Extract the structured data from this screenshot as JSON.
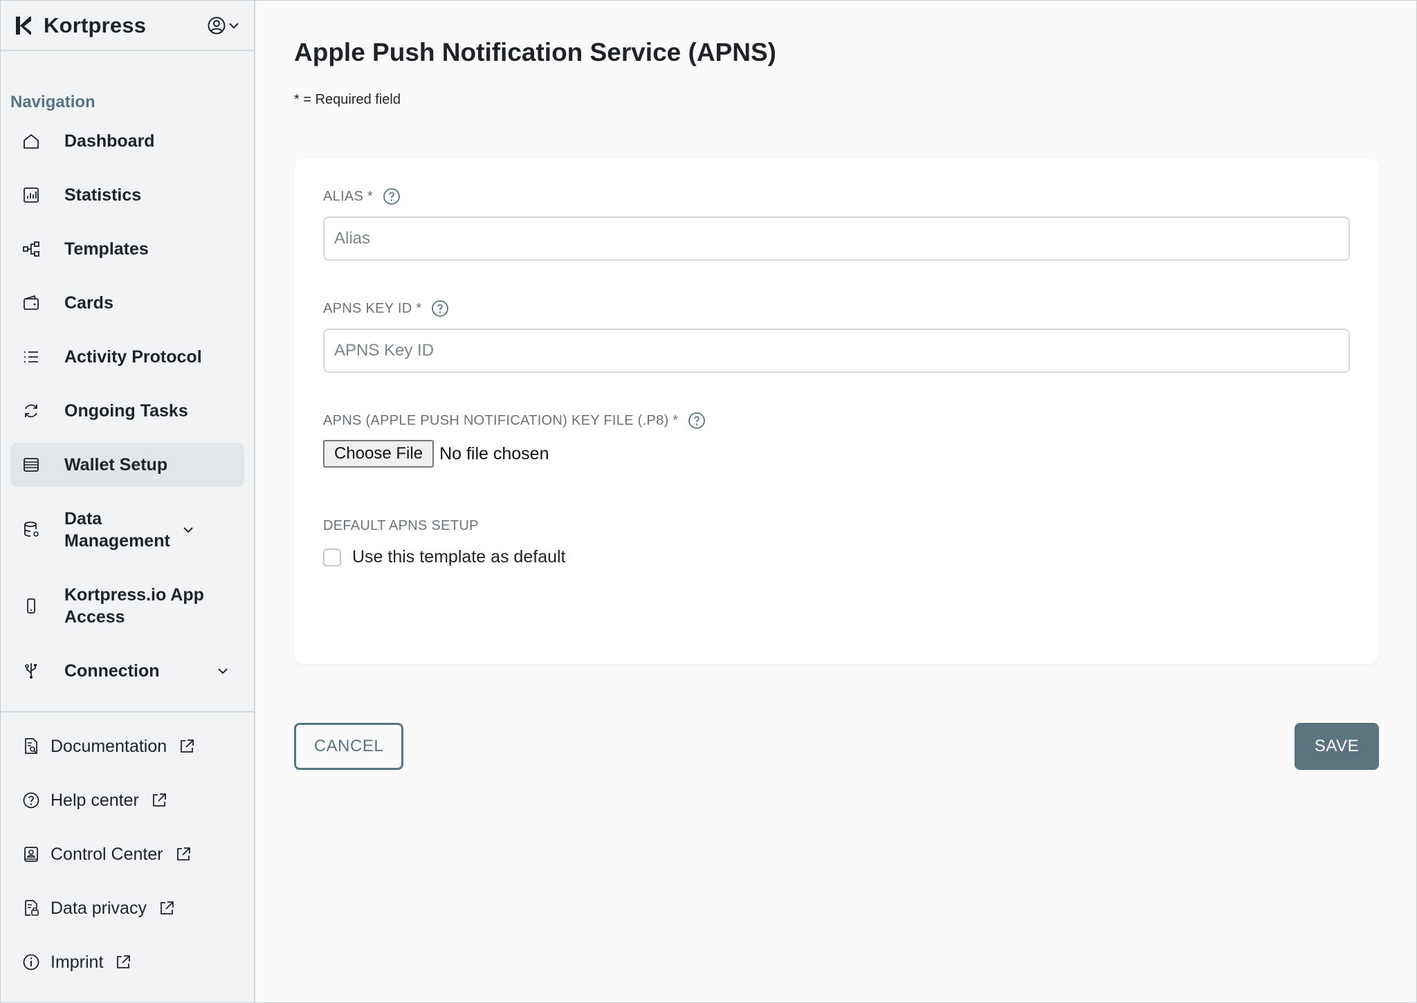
{
  "app": {
    "name": "Kortpress",
    "account_icon": "user-circle-icon"
  },
  "sidebar": {
    "heading": "Navigation",
    "items": [
      {
        "label": "Dashboard",
        "icon": "home-icon"
      },
      {
        "label": "Statistics",
        "icon": "bar-chart-icon"
      },
      {
        "label": "Templates",
        "icon": "hierarchy-icon"
      },
      {
        "label": "Cards",
        "icon": "wallet-icon"
      },
      {
        "label": "Activity Protocol",
        "icon": "list-check-icon"
      },
      {
        "label": "Ongoing Tasks",
        "icon": "refresh-icon"
      },
      {
        "label": "Wallet Setup",
        "icon": "stack-icon",
        "active": true
      },
      {
        "label": "Data Management",
        "icon": "database-icon",
        "expandable": true
      },
      {
        "label": "Kortpress.io App Access",
        "icon": "phone-icon"
      },
      {
        "label": "Connection",
        "icon": "usb-icon",
        "expandable": true
      }
    ],
    "external_links": [
      {
        "label": "Documentation",
        "icon": "document-search-icon"
      },
      {
        "label": "Help center",
        "icon": "help-circle-icon"
      },
      {
        "label": "Control Center",
        "icon": "id-badge-icon"
      },
      {
        "label": "Data privacy",
        "icon": "document-lock-icon"
      },
      {
        "label": "Imprint",
        "icon": "info-circle-icon"
      }
    ]
  },
  "main": {
    "title": "Apple Push Notification Service (APNS)",
    "required_note": "* = Required field",
    "form": {
      "alias": {
        "label": "ALIAS *",
        "placeholder": "Alias",
        "value": ""
      },
      "key_id": {
        "label": "APNS KEY ID *",
        "placeholder": "APNS Key ID",
        "value": ""
      },
      "key_file": {
        "label": "APNS (APPLE PUSH NOTIFICATION) KEY FILE (.P8) *",
        "button": "Choose File",
        "status": "No file chosen"
      },
      "default_setup": {
        "label": "DEFAULT APNS SETUP",
        "checkbox_label": "Use this template as default",
        "checked": false
      }
    },
    "actions": {
      "cancel": "CANCEL",
      "save": "SAVE"
    }
  },
  "colors": {
    "accent": "#5a7580",
    "sidebar_bg": "#f1f3f4",
    "active_item_bg": "#e1e6e8",
    "card_bg": "#ffffff"
  }
}
